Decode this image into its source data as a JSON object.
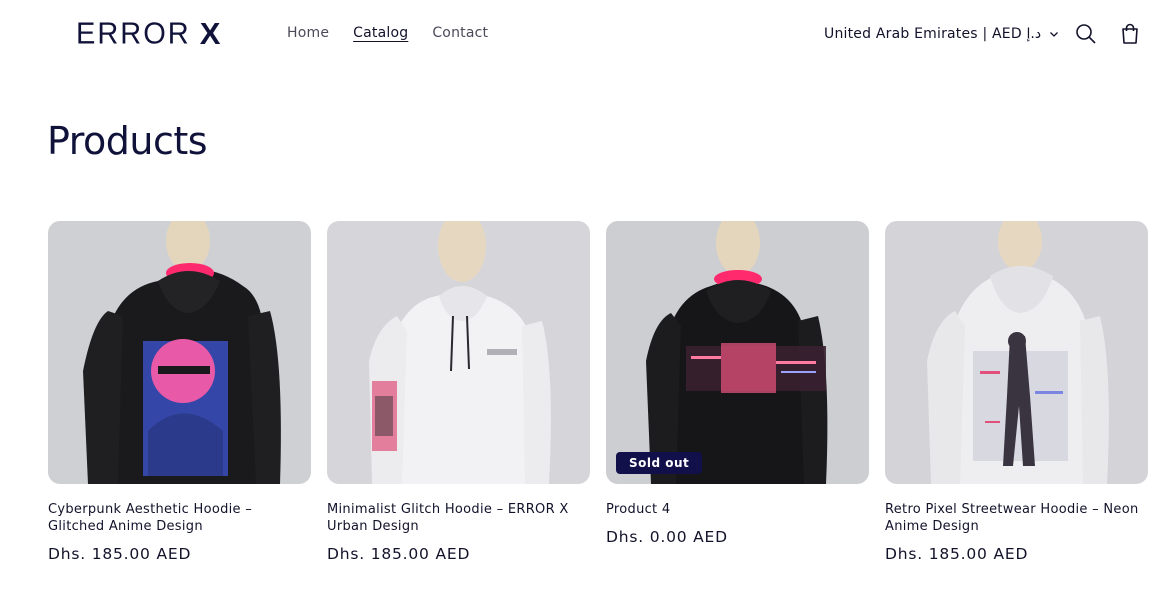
{
  "header": {
    "logo_main": "ERROR",
    "logo_x": "X",
    "nav": [
      {
        "label": "Home"
      },
      {
        "label": "Catalog"
      },
      {
        "label": "Contact"
      }
    ],
    "locale": "United Arab Emirates | AED د.إ"
  },
  "page": {
    "title": "Products"
  },
  "products": [
    {
      "title": "Cyberpunk Aesthetic Hoodie – Glitched Anime Design",
      "price": "Dhs. 185.00 AED",
      "hoodie_color": "#1a1a1c",
      "badge": null
    },
    {
      "title": "Minimalist Glitch Hoodie – ERROR X Urban Design",
      "price": "Dhs. 185.00 AED",
      "hoodie_color": "#f2f2f4",
      "badge": null
    },
    {
      "title": "Product 4",
      "price": "Dhs. 0.00 AED",
      "hoodie_color": "#161618",
      "badge": "Sold out"
    },
    {
      "title": "Retro Pixel Streetwear Hoodie – Neon Anime Design",
      "price": "Dhs. 185.00 AED",
      "hoodie_color": "#eeeef0",
      "badge": null
    }
  ],
  "colors": {
    "brand_navy": "#10123a",
    "badge_bg": "#12104a",
    "accent_pink": "#ff2a6d"
  }
}
